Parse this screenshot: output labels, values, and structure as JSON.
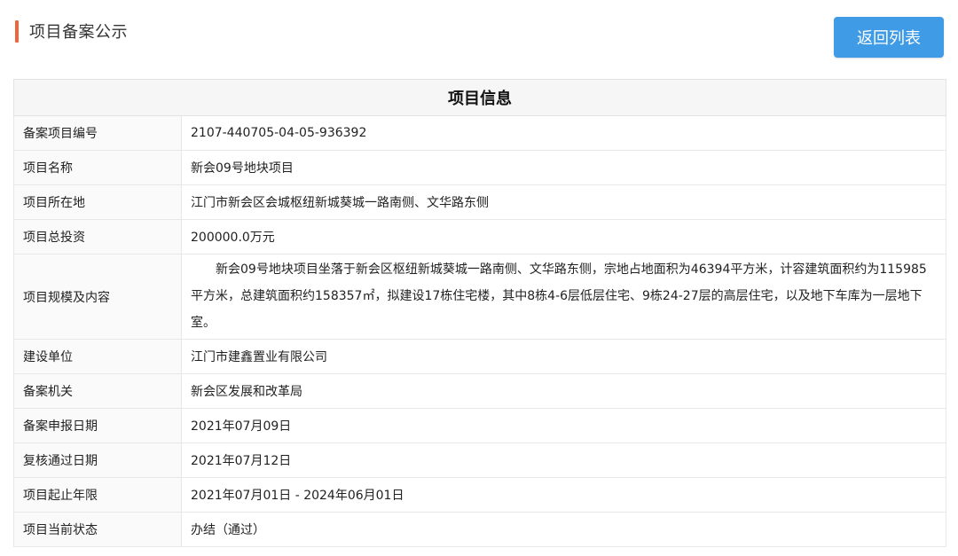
{
  "header": {
    "title": "项目备案公示",
    "back_label": "返回列表",
    "accent_color": "#f0643c",
    "button_color": "#3f9be6"
  },
  "table": {
    "heading": "项目信息",
    "rows": [
      {
        "label": "备案项目编号",
        "value": "2107-440705-04-05-936392"
      },
      {
        "label": "项目名称",
        "value": "新会09号地块项目"
      },
      {
        "label": "项目所在地",
        "value": "江门市新会区会城枢纽新城葵城一路南侧、文华路东侧"
      },
      {
        "label": "项目总投资",
        "value": "200000.0万元"
      },
      {
        "label": "项目规模及内容",
        "value": "新会09号地块项目坐落于新会区枢纽新城葵城一路南侧、文华路东侧，宗地占地面积为46394平方米，计容建筑面积约为115985平方米，总建筑面积约158357㎡，拟建设17栋住宅楼，其中8栋4-6层低层住宅、9栋24-27层的高层住宅，以及地下车库为一层地下室。"
      },
      {
        "label": "建设单位",
        "value": "江门市建鑫置业有限公司"
      },
      {
        "label": "备案机关",
        "value": "新会区发展和改革局"
      },
      {
        "label": "备案申报日期",
        "value": "2021年07月09日"
      },
      {
        "label": "复核通过日期",
        "value": "2021年07月12日"
      },
      {
        "label": "项目起止年限",
        "value": "2021年07月01日 - 2024年06月01日"
      },
      {
        "label": "项目当前状态",
        "value": "办结（通过）"
      }
    ]
  }
}
